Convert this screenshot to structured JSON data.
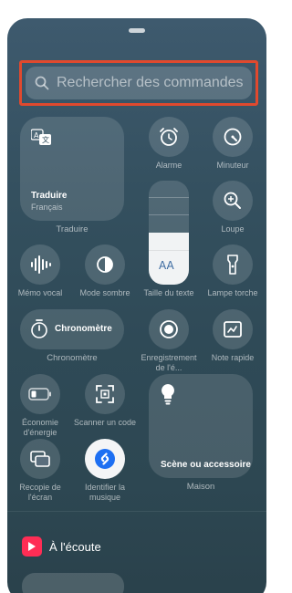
{
  "search": {
    "placeholder": "Rechercher des commandes"
  },
  "controls": {
    "translate": {
      "title": "Traduire",
      "subtitle": "Français",
      "label": "Traduire"
    },
    "alarm": {
      "label": "Alarme"
    },
    "timer": {
      "label": "Minuteur"
    },
    "magnifier": {
      "label": "Loupe"
    },
    "voice_memo": {
      "label": "Mémo vocal"
    },
    "dark_mode": {
      "label": "Mode sombre"
    },
    "text_size": {
      "label": "Taille du texte",
      "glyph": "AA"
    },
    "flashlight": {
      "label": "Lampe torche"
    },
    "stopwatch": {
      "title": "Chronomètre",
      "label": "Chronomètre"
    },
    "screen_recording": {
      "label": "Enregistre­ment de l'é..."
    },
    "quick_note": {
      "label": "Note rapide"
    },
    "low_power": {
      "label": "Économie d'énergie"
    },
    "code_scanner": {
      "label": "Scanner un code"
    },
    "home": {
      "title": "Scène ou accessoire",
      "label": "Maison"
    },
    "screen_mirroring": {
      "label": "Recopie de l'écran"
    },
    "shazam": {
      "label": "Identifier la musique"
    }
  },
  "now_playing": {
    "title": "À l'écoute"
  },
  "colors": {
    "highlight": "#e0492e",
    "now_playing_icon": "#ff2d55"
  }
}
